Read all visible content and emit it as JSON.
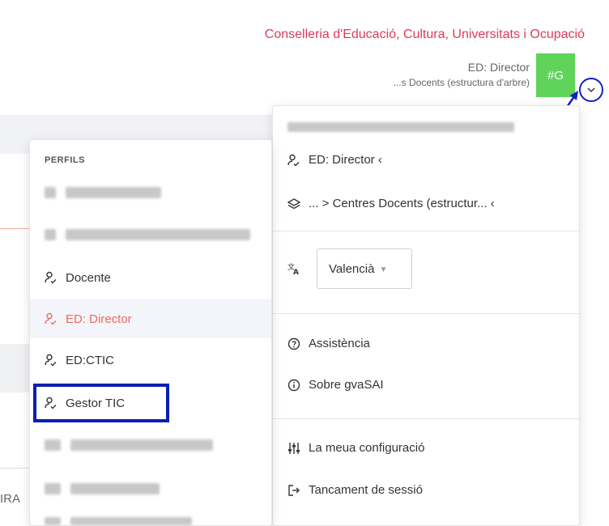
{
  "header": {
    "org_title": "Conselleria d'Educació, Cultura, Universitats i Ocupació",
    "user_name": "ED: Director",
    "user_context": "...s Docents (estructura d'arbre)",
    "avatar_label": "#G",
    "accent_color": "#e0385a",
    "avatar_color": "#5fd35a"
  },
  "account_menu": {
    "profile_label": "ED: Director ‹",
    "center_label": "... > Centres Docents (estructur... ‹",
    "language": "Valencià",
    "help_label": "Assistència",
    "about_label": "Sobre gvaSAI",
    "settings_label": "La meua configuració",
    "logout_label": "Tancament de sessió"
  },
  "profile_menu": {
    "header": "PERFILS",
    "items": [
      {
        "label": "Docente",
        "state": "normal"
      },
      {
        "label": "ED: Director",
        "state": "active"
      },
      {
        "label": "ED:CTIC",
        "state": "normal"
      },
      {
        "label": "Gestor TIC",
        "state": "highlighted"
      }
    ],
    "active_color": "#ee6b5d",
    "highlight_color": "#0a1fb0"
  },
  "background": {
    "partial_text": "IRA"
  }
}
